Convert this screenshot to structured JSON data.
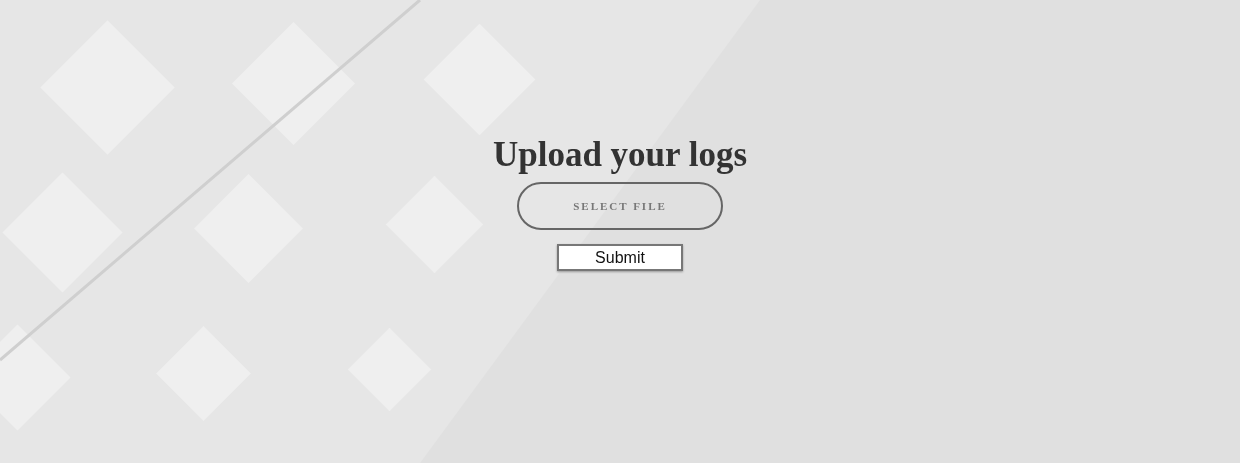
{
  "heading": "Upload your logs",
  "file_button": {
    "label": "SELECT FILE"
  },
  "submit_button": {
    "label": "Submit"
  }
}
